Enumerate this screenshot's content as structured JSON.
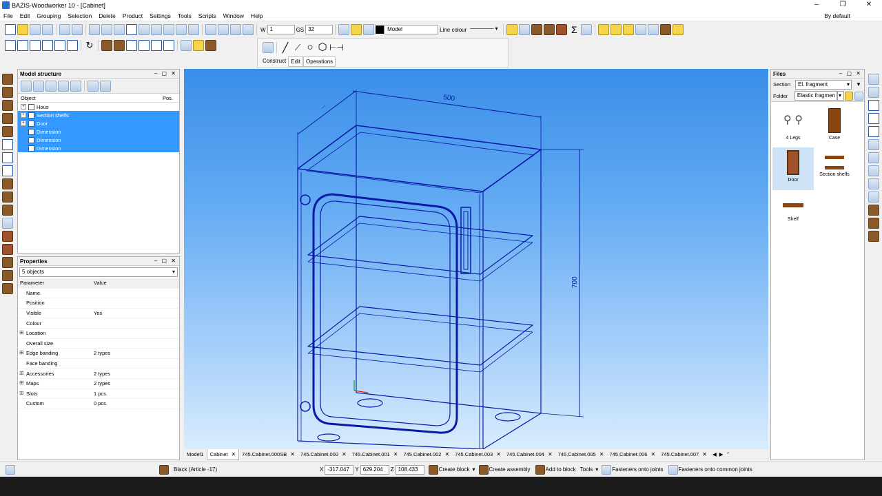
{
  "window": {
    "title": "BAZIS-Woodworker 10 - [Cabinet]",
    "by_default": "By default"
  },
  "menu": [
    "File",
    "Edit",
    "Grouping",
    "Selection",
    "Delete",
    "Product",
    "Settings",
    "Tools",
    "Scripts",
    "Window",
    "Help"
  ],
  "toolbar": {
    "w_label": "W",
    "w_value": "1",
    "gs_label": "GS",
    "gs_value": "32",
    "layer_value": "Model",
    "line_colour_label": "Line colour"
  },
  "construct_tabs": [
    "Construct",
    "Edit",
    "Operations"
  ],
  "model_structure": {
    "title": "Model structure",
    "col_object": "Object",
    "col_pos": "Pos.",
    "items": [
      {
        "label": "Hous",
        "selected": false
      },
      {
        "label": "Section shelfs",
        "selected": true
      },
      {
        "label": "Door",
        "selected": true
      },
      {
        "label": "Dimension",
        "selected": true
      },
      {
        "label": "Dimension",
        "selected": true
      },
      {
        "label": "Dimension",
        "selected": true
      }
    ]
  },
  "properties": {
    "title": "Properties",
    "selection": "5 objects",
    "col_param": "Parameter",
    "col_value": "Value",
    "rows": [
      {
        "name": "Name",
        "value": ""
      },
      {
        "name": "Position",
        "value": ""
      },
      {
        "name": "Visible",
        "value": "Yes"
      },
      {
        "name": "Colour",
        "value": ""
      },
      {
        "name": "Location",
        "value": ""
      },
      {
        "name": "Overall size",
        "value": ""
      },
      {
        "name": "Edge banding",
        "value": "2 types"
      },
      {
        "name": "Face banding",
        "value": ""
      },
      {
        "name": "Accessories",
        "value": "2 types"
      },
      {
        "name": "Maps",
        "value": "2 types"
      },
      {
        "name": "Slots",
        "value": "1 pcs."
      },
      {
        "name": "Custom",
        "value": "0 pcs."
      }
    ]
  },
  "files": {
    "title": "Files",
    "section_label": "Section",
    "section_value": "El. fragment",
    "folder_label": "Folder",
    "folder_value": "Elastic fragmen",
    "items": [
      "4 Legs",
      "Case",
      "Door",
      "Section shelfs",
      "Shelf"
    ]
  },
  "drawing": {
    "width_dim": "500",
    "height_dim": "700",
    "depth_dim": "..."
  },
  "tabs": [
    "Model1",
    "Cabinet",
    "745.Cabinet.000SB",
    "745.Cabinet.000",
    "745.Cabinet.001",
    "745.Cabinet.002",
    "745.Cabinet.003",
    "745.Cabinet.004",
    "745.Cabinet.005",
    "745.Cabinet.006",
    "745.Cabinet.007"
  ],
  "status": {
    "material": "Black (Article -17)",
    "x_label": "X",
    "x": "-317.047",
    "y_label": "Y",
    "y": "629.204",
    "z_label": "Z",
    "z": "108.433",
    "create_block": "Create block",
    "create_assembly": "Create assembly",
    "add_to_block": "Add to block",
    "tools": "Tools",
    "fasteners_joints": "Fasteners onto joints",
    "fasteners_common": "Fasteners onto common joints"
  }
}
